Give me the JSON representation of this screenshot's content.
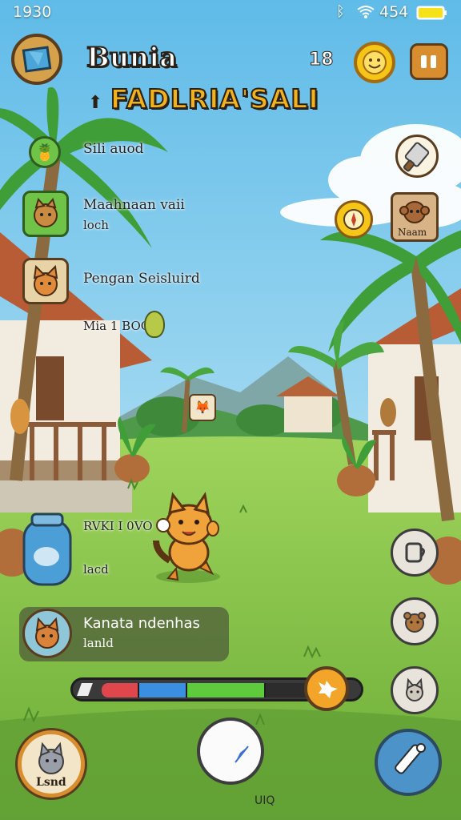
{
  "status_bar": {
    "time": "1930",
    "battery_level": "454"
  },
  "header": {
    "title": "Bunia",
    "subtitle": "FADLRIA'SALI",
    "counter": "18",
    "coin_icon": "smiley-coin-icon",
    "menu_icon": "grid-menu-icon",
    "map_icon": "map-icon"
  },
  "quests": [
    {
      "label": "Sili auod",
      "sublabel": "",
      "icon": "pineapple-icon"
    },
    {
      "label": "Maahnaan vaii",
      "sublabel": "loch",
      "icon": "fox-portrait-icon"
    },
    {
      "label": "Pengan Seisluird",
      "sublabel": "",
      "icon": "cat-portrait-icon"
    },
    {
      "label": "Mia 1 BOG",
      "sublabel": "",
      "icon": "pear-icon"
    }
  ],
  "right_panel": {
    "tool_icon": "cleaver-icon",
    "compass_icon": "compass-icon",
    "character_label": "Naam"
  },
  "jar_label": {
    "title": "RVKI I 0VO",
    "sub": "lacd"
  },
  "npc_dialog": {
    "name": "Kanata ndenhas",
    "sub": "lanld"
  },
  "energy_bar": {
    "segments": [
      {
        "color": "#e0474c",
        "fraction": 0.14
      },
      {
        "color": "#3b8fe0",
        "fraction": 0.18
      },
      {
        "color": "#5ecb3d",
        "fraction": 0.3
      },
      {
        "color": "#2c2c2c",
        "fraction": 0.16
      }
    ]
  },
  "side_buttons": [
    "mug-icon",
    "bear-face-icon",
    "cat-face-icon"
  ],
  "bottom": {
    "profile_label": "Lsnd",
    "compass_icon": "compass-needle-icon",
    "tool_icon": "pen-tool-icon",
    "footer_text": "UIQ"
  },
  "colors": {
    "sky": "#8fd0f0",
    "grass": "#7bbf44",
    "accent": "#f2b21c"
  }
}
